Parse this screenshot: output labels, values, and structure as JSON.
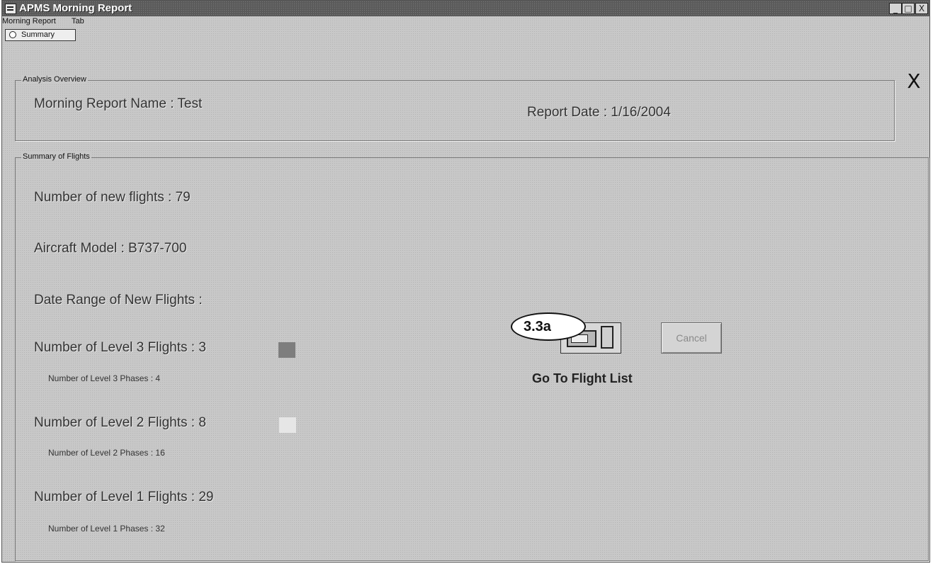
{
  "window": {
    "title": "APMS Morning Report",
    "controls": {
      "minimize": "_",
      "maximize": "□",
      "close": "X"
    }
  },
  "menu": [
    "Morning Report",
    "Tab"
  ],
  "tab": {
    "label": "Summary"
  },
  "close_icon_glyph": "X",
  "analysis_overview": {
    "legend": "Analysis Overview",
    "report_name": "Morning Report Name : Test",
    "report_date": "Report Date : 1/16/2004"
  },
  "summary": {
    "legend": "Summary of Flights",
    "new_flights": "Number of new flights :  79",
    "aircraft_model": "Aircraft Model : B737-700",
    "date_range": "Date Range of New Flights :",
    "level3_flights": "Number of Level 3 Flights : 3",
    "level3_phases": "Number of Level 3 Phases : 4",
    "level2_flights": "Number of Level 2 Flights : 8",
    "level2_phases": "Number of Level 2 Phases : 16",
    "level1_flights": "Number of Level 1 Flights : 29",
    "level1_phases": "Number of Level 1 Phases : 32"
  },
  "colors": {
    "level3": "#7e7e7e",
    "level2": "#e6e6e6",
    "window_bg": "#c8c8c8",
    "titlebar": "#5a5a5a"
  },
  "icons": {
    "app": "app-icon",
    "flight_list": "flight-list-icon",
    "close": "close-icon"
  },
  "actions": {
    "callout": "3.3a",
    "go_to_flight_list": "Go To Flight List",
    "cancel": "Cancel"
  }
}
